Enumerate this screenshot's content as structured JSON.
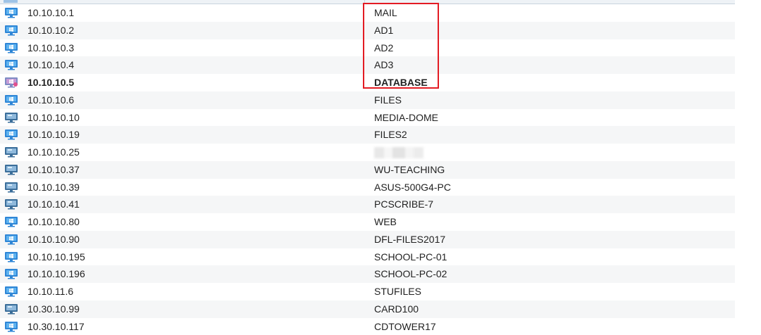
{
  "colors": {
    "highlight": "#e31b23",
    "row_alt": "#f5f6f7"
  },
  "rows": [
    {
      "ip": "10.10.10.1",
      "name": "MAIL",
      "icon": "windows-host-icon"
    },
    {
      "ip": "10.10.10.2",
      "name": "AD1",
      "icon": "windows-host-icon"
    },
    {
      "ip": "10.10.10.3",
      "name": "AD2",
      "icon": "windows-host-icon"
    },
    {
      "ip": "10.10.10.4",
      "name": "AD3",
      "icon": "windows-host-icon"
    },
    {
      "ip": "10.10.10.5",
      "name": "DATABASE",
      "icon": "windows-host-alert-icon",
      "bold": true
    },
    {
      "ip": "10.10.10.6",
      "name": "FILES",
      "icon": "windows-host-icon"
    },
    {
      "ip": "10.10.10.10",
      "name": "MEDIA-DOME",
      "icon": "monitor-host-icon"
    },
    {
      "ip": "10.10.10.19",
      "name": "FILES2",
      "icon": "windows-host-icon"
    },
    {
      "ip": "10.10.10.25",
      "name": "",
      "icon": "monitor-host-icon",
      "redacted": true
    },
    {
      "ip": "10.10.10.37",
      "name": "WU-TEACHING",
      "icon": "monitor-host-icon"
    },
    {
      "ip": "10.10.10.39",
      "name": "ASUS-500G4-PC",
      "icon": "monitor-host-icon"
    },
    {
      "ip": "10.10.10.41",
      "name": "PCSCRIBE-7",
      "icon": "monitor-host-icon"
    },
    {
      "ip": "10.10.10.80",
      "name": "WEB",
      "icon": "windows-host-icon"
    },
    {
      "ip": "10.10.10.90",
      "name": "DFL-FILES2017",
      "icon": "windows-host-icon"
    },
    {
      "ip": "10.10.10.195",
      "name": "SCHOOL-PC-01",
      "icon": "windows-host-icon"
    },
    {
      "ip": "10.10.10.196",
      "name": "SCHOOL-PC-02",
      "icon": "windows-host-icon"
    },
    {
      "ip": "10.10.11.6",
      "name": "STUFILES",
      "icon": "windows-host-icon"
    },
    {
      "ip": "10.30.10.99",
      "name": "CARD100",
      "icon": "monitor-host-icon"
    },
    {
      "ip": "10.30.10.117",
      "name": "CDTOWER17",
      "icon": "windows-host-icon"
    }
  ]
}
